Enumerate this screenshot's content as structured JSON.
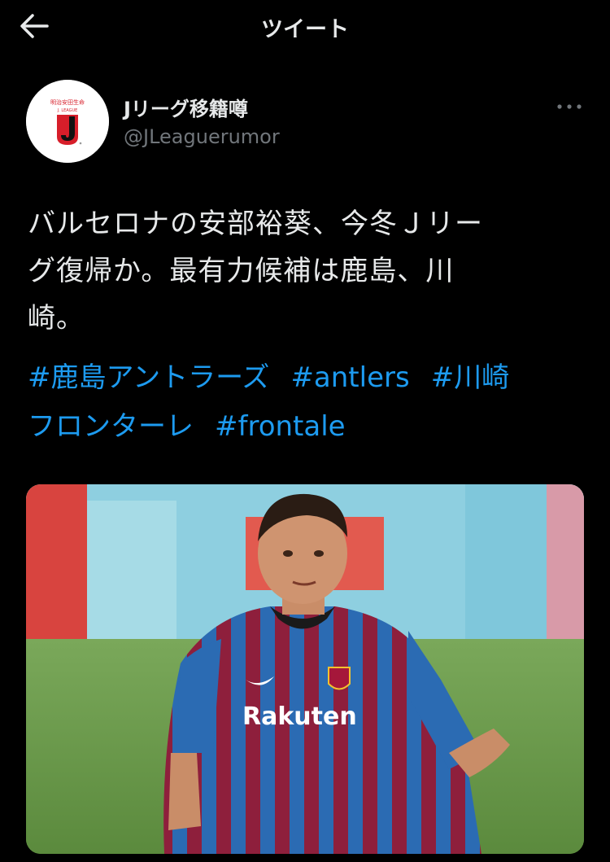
{
  "header": {
    "title": "ツイート",
    "back_icon": "arrow-left-icon"
  },
  "author": {
    "display_name": "Jリーグ移籍噂",
    "handle": "@JLeaguerumor",
    "avatar_icon": "j-league-logo",
    "avatar_label_top": "明治安田生命",
    "avatar_label_bottom": "J. LEAGUE"
  },
  "tweet": {
    "lines": [
      "バルセロナの安部裕葵、今冬Ｊリー",
      "グ復帰か。最有力候補は鹿島、川",
      "崎。"
    ],
    "hashtags": [
      "#鹿島アントラーズ",
      "#antlers",
      "#川崎",
      "フロンターレ",
      "#frontale"
    ],
    "image": {
      "shirt_sponsor": "Rakuten"
    }
  },
  "colors": {
    "background": "#000000",
    "text": "#e7e9ea",
    "muted": "#71767b",
    "link": "#1d9bf0"
  }
}
